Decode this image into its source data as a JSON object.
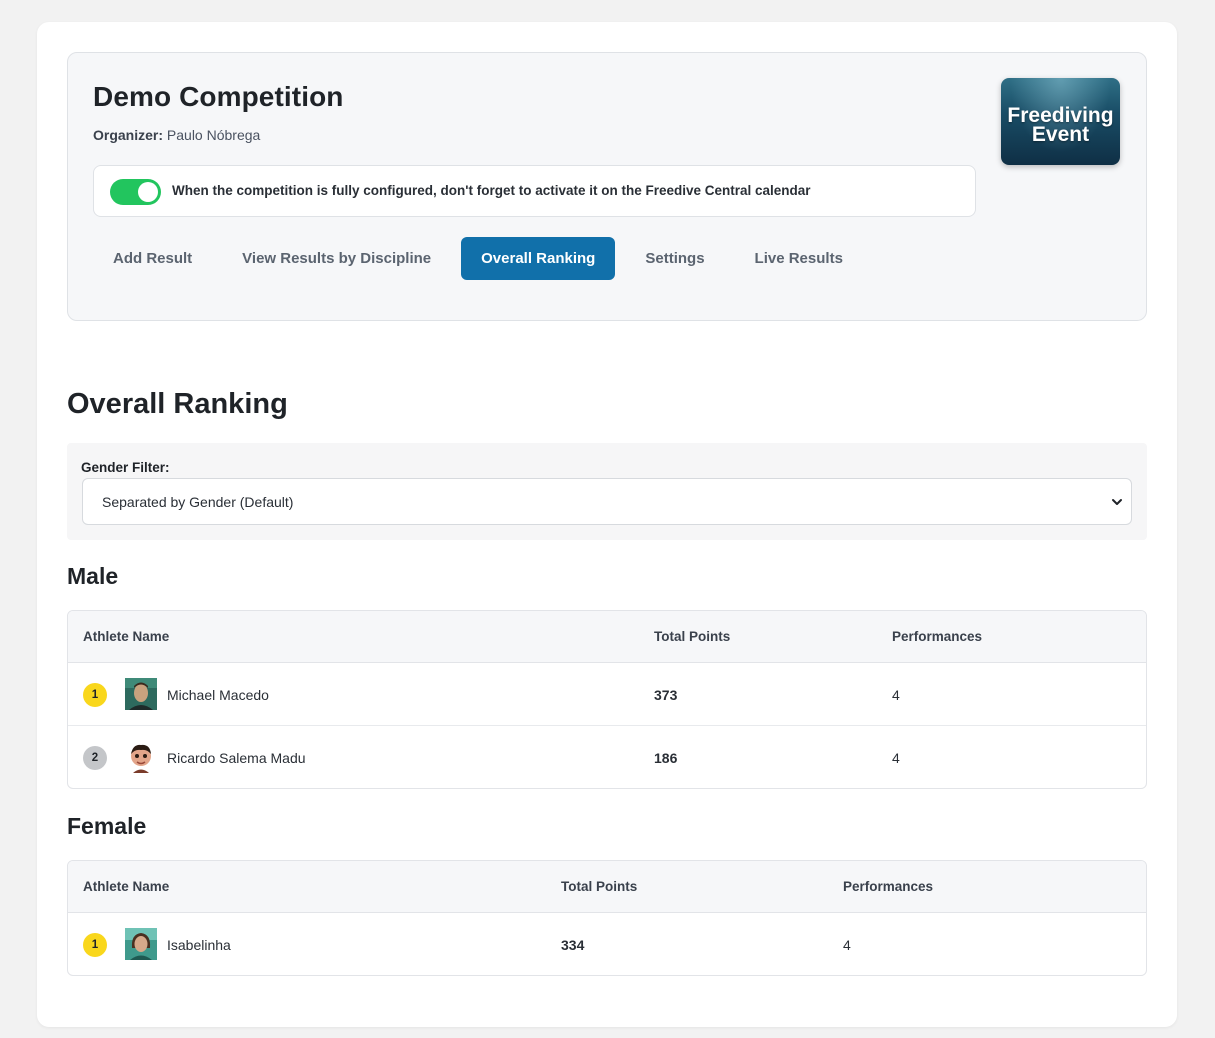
{
  "competition": {
    "title": "Demo Competition",
    "organizer_label": "Organizer:",
    "organizer_name": "Paulo Nóbrega",
    "notice": "When the competition is fully configured, don't forget to activate it on the Freedive Central calendar",
    "toggle_state": "on",
    "logo_line1": "Freediving",
    "logo_line2": "Event"
  },
  "tabs": [
    {
      "label": "Add Result",
      "active": false
    },
    {
      "label": "View Results by Discipline",
      "active": false
    },
    {
      "label": "Overall Ranking",
      "active": true
    },
    {
      "label": "Settings",
      "active": false
    },
    {
      "label": "Live Results",
      "active": false
    }
  ],
  "ranking": {
    "title": "Overall Ranking",
    "filter_label": "Gender Filter:",
    "filter_value": "Separated by Gender (Default)"
  },
  "male": {
    "title": "Male",
    "headers": {
      "name": "Athlete Name",
      "points": "Total Points",
      "performances": "Performances"
    },
    "rows": [
      {
        "rank": "1",
        "name": "Michael Macedo",
        "points": "373",
        "performances": "4"
      },
      {
        "rank": "2",
        "name": "Ricardo Salema Madu",
        "points": "186",
        "performances": "4"
      }
    ]
  },
  "female": {
    "title": "Female",
    "headers": {
      "name": "Athlete Name",
      "points": "Total Points",
      "performances": "Performances"
    },
    "rows": [
      {
        "rank": "1",
        "name": "Isabelinha",
        "points": "334",
        "performances": "4"
      }
    ]
  },
  "colors": {
    "accent": "#1170aa",
    "toggle_on": "#22c55e",
    "gold": "#f9d71c",
    "silver": "#c4c6c9"
  }
}
